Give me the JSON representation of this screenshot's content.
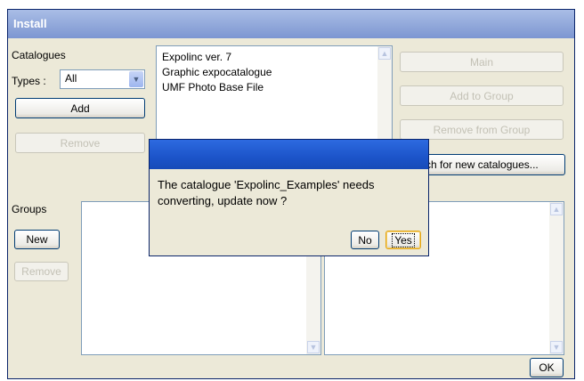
{
  "window": {
    "title": "Install"
  },
  "catalogues": {
    "label": "Catalogues",
    "types_label": "Types :",
    "types_value": "All",
    "add_label": "Add",
    "remove_label": "Remove",
    "items": [
      "Expolinc ver. 7",
      "Graphic expocatalogue",
      "UMF Photo Base File"
    ]
  },
  "right_buttons": {
    "main": "Main",
    "add_to_group": "Add to Group",
    "remove_from_group": "Remove from Group",
    "search_visible": "ch for new catalogues..."
  },
  "groups": {
    "label": "Groups",
    "new_label": "New",
    "remove_label": "Remove"
  },
  "dialog": {
    "message_line1": "The catalogue 'Expolinc_Examples' needs",
    "message_line2": "converting, update now ?",
    "no_label": "No",
    "yes_label": "Yes"
  },
  "footer": {
    "ok_label": "OK"
  },
  "colors": {
    "title_bar": "#8fa6d9",
    "dialog_title": "#1c54c9",
    "window_bg": "#ece9d8"
  }
}
